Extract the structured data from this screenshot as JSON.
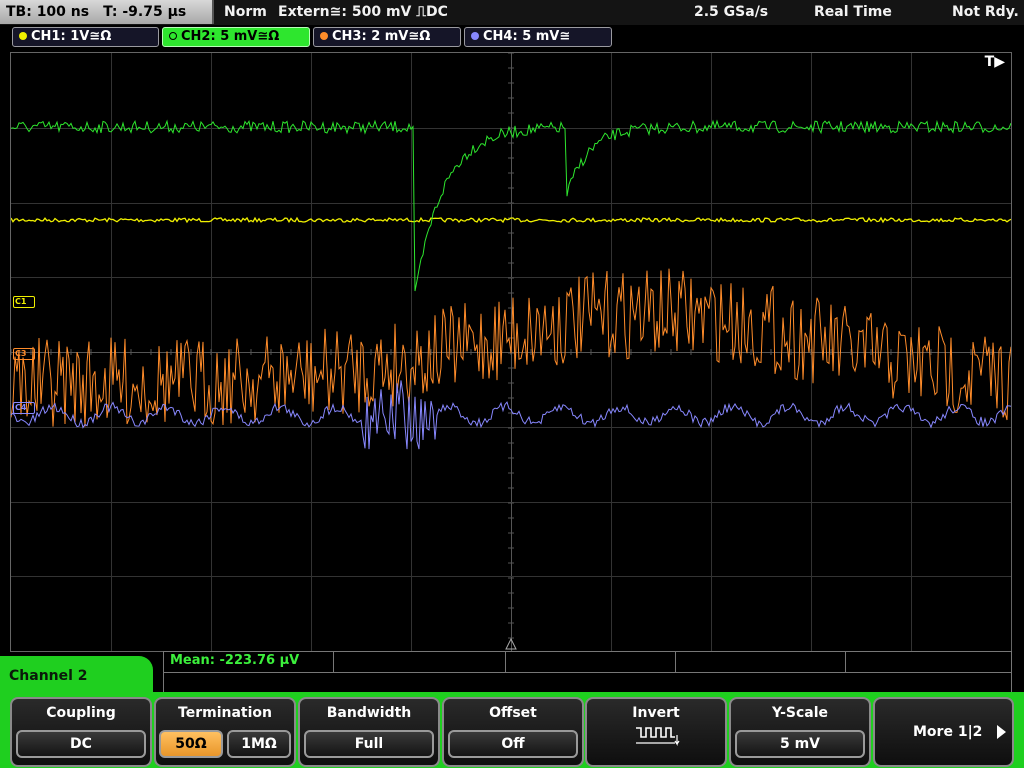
{
  "status": {
    "timebase": "TB: 100 ns",
    "trigger_time": "T: -9.75 µs",
    "mode": "Norm",
    "trigger_source": "Extern≅: 500 mV ⎍DC",
    "sample_rate": "2.5 GSa/s",
    "acq_mode": "Real Time",
    "state": "Not Rdy."
  },
  "channels": [
    {
      "label": "CH1: 1V≅Ω",
      "color": "#f0f000",
      "active": false
    },
    {
      "label": "CH2: 5 mV≅Ω",
      "color": "#2ee62e",
      "active": true
    },
    {
      "label": "CH3: 2 mV≅Ω",
      "color": "#ff8c2a",
      "active": false
    },
    {
      "label": "CH4: 5 mV≅",
      "color": "#8888ff",
      "active": false
    }
  ],
  "screen": {
    "trigger_label": "T▶",
    "markers": [
      {
        "label": "C1",
        "color": "#f0f000"
      },
      {
        "label": "C3",
        "color": "#ff8c2a"
      },
      {
        "label": "C4",
        "color": "#8888ff"
      }
    ]
  },
  "measurement": {
    "mean": "Mean: -223.76 µV"
  },
  "menu": {
    "title": "Channel 2",
    "coupling": {
      "title": "Coupling",
      "value": "DC"
    },
    "termination": {
      "title": "Termination",
      "option1": "50Ω",
      "option2": "1MΩ"
    },
    "bandwidth": {
      "title": "Bandwidth",
      "value": "Full"
    },
    "offset": {
      "title": "Offset",
      "value": "Off"
    },
    "invert": {
      "title": "Invert",
      "icon": "invert-waveform-icon"
    },
    "yscale": {
      "title": "Y-Scale",
      "value": "5 mV"
    },
    "more": "More 1|2"
  }
}
